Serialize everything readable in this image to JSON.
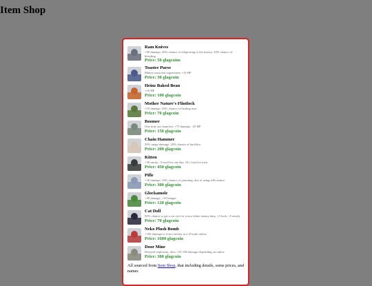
{
  "page": {
    "title": "Item Shop"
  },
  "items": [
    {
      "name": "Ram Knives",
      "desc": "+90 damage, 20% chance of teleporting to the matrix, 30% chance of bleeding",
      "price": "Price: 50 glagcoins",
      "thumb": "#6a6f7a"
    },
    {
      "name": "Toaster Purse",
      "desc": "Makes toast that regenerates +10 HP",
      "price": "Price: 30 glagcoin",
      "thumb": "#4a5a8a"
    },
    {
      "name": "Heinz Baked Bean",
      "desc": "+10 HP",
      "price": "Price: 100 glagcoin",
      "thumb": "#c8642a"
    },
    {
      "name": "Mother Nature's Flintlock",
      "desc": "+10 damage, 20% chance of healing user",
      "price": "Price: 70 glagcoin",
      "thumb": "#5a7a3a"
    },
    {
      "name": "Boomer",
      "desc": "One time use launcher, +75 damage, -25 HP",
      "price": "Price: 150 glagcoin",
      "thumb": "#7a8a7a"
    },
    {
      "name": "Chain Hammer",
      "desc": "20% range damage, 20% chance of backfire",
      "price": "Price: 200 glagcoin",
      "thumb": "#d8c8b8"
    },
    {
      "name": "Kitten",
      "desc": "+30 sanity, -5 food for one day, 10+ food for men",
      "price": "Price: 450 glagcoin",
      "thumb": "#3a3a3a"
    },
    {
      "name": "Pifle",
      "desc": "+30 damage, 10% chance of jamming, due to using rifle ammo",
      "price": "Price: 300 glagcoin",
      "thumb": "#8a9ab8"
    },
    {
      "name": "Glockamole",
      "desc": "+30 damage, +10 hunger",
      "price": "Price: 120 glagcoin",
      "thumb": "#4a8a3a"
    },
    {
      "name": "Cat Doll",
      "desc": "50% chance to get a cat eye for every feline enemy data, +5 luck, +5 attack",
      "price": "Price: 70 glagcoin",
      "thumb": "#2a2a3a"
    },
    {
      "name": "Neko Plush Bomb",
      "desc": "+100 damage to every enemy in a 25 mile radius",
      "price": "Price: 1600 glagcoin",
      "thumb": "#b83a3a"
    },
    {
      "name": "Door Mine",
      "desc": "Delayed explosion, does +25-100 damage depending on radius",
      "price": "Price: 300 glagcoin",
      "thumb": "#8a8a7a"
    }
  ],
  "footer": {
    "before": "All sourced from ",
    "link": "Item Shop",
    "after": ", that including details, some prices, and names"
  }
}
